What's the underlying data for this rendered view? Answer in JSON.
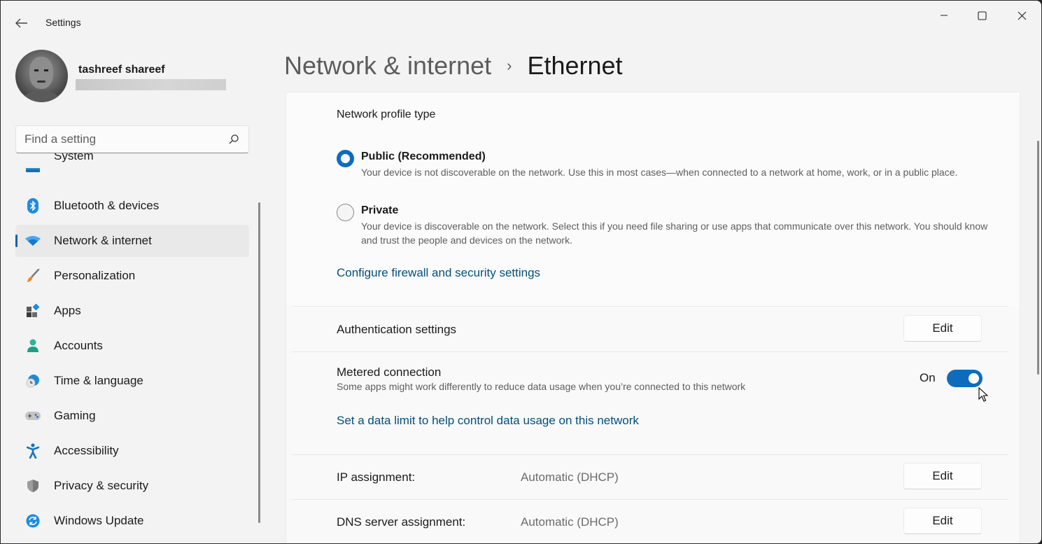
{
  "window": {
    "title": "Settings",
    "controls": {
      "minimize": "minimize-icon",
      "maximize": "maximize-icon",
      "close": "close-icon"
    }
  },
  "user": {
    "name": "tashreef shareef",
    "email_redacted": true
  },
  "search": {
    "placeholder": "Find a setting",
    "value": ""
  },
  "sidebar": {
    "items": [
      {
        "label": "System",
        "icon": "system-icon",
        "active": false
      },
      {
        "label": "Bluetooth & devices",
        "icon": "bluetooth-icon",
        "active": false
      },
      {
        "label": "Network & internet",
        "icon": "wifi-icon",
        "active": true
      },
      {
        "label": "Personalization",
        "icon": "brush-icon",
        "active": false
      },
      {
        "label": "Apps",
        "icon": "apps-icon",
        "active": false
      },
      {
        "label": "Accounts",
        "icon": "person-icon",
        "active": false
      },
      {
        "label": "Time & language",
        "icon": "globe-clock-icon",
        "active": false
      },
      {
        "label": "Gaming",
        "icon": "gamepad-icon",
        "active": false
      },
      {
        "label": "Accessibility",
        "icon": "accessibility-icon",
        "active": false
      },
      {
        "label": "Privacy & security",
        "icon": "shield-icon",
        "active": false
      },
      {
        "label": "Windows Update",
        "icon": "update-icon",
        "active": false
      }
    ]
  },
  "breadcrumb": {
    "parent": "Network & internet",
    "separator": "›",
    "current": "Ethernet"
  },
  "network_profile": {
    "title": "Network profile type",
    "selected": "public",
    "options": [
      {
        "id": "public",
        "label": "Public (Recommended)",
        "description": "Your device is not discoverable on the network. Use this in most cases—when connected to a network at home, work, or in a public place."
      },
      {
        "id": "private",
        "label": "Private",
        "description": "Your device is discoverable on the network. Select this if you need file sharing or use apps that communicate over this network. You should know and trust the people and devices on the network."
      }
    ],
    "firewall_link": "Configure firewall and security settings"
  },
  "authentication": {
    "label": "Authentication settings",
    "button": "Edit"
  },
  "metered": {
    "label": "Metered connection",
    "description": "Some apps might work differently to reduce data usage when you’re connected to this network",
    "state_label": "On",
    "enabled": true,
    "data_limit_link": "Set a data limit to help control data usage on this network"
  },
  "ip_assignment": {
    "label": "IP assignment:",
    "value": "Automatic (DHCP)",
    "button": "Edit"
  },
  "dns_assignment": {
    "label": "DNS server assignment:",
    "value": "Automatic (DHCP)",
    "button": "Edit"
  },
  "colors": {
    "accent": "#0f6cbd",
    "link": "#00507e",
    "active_indicator": "#0f5fb0",
    "window_bg": "#f3f3f3"
  }
}
